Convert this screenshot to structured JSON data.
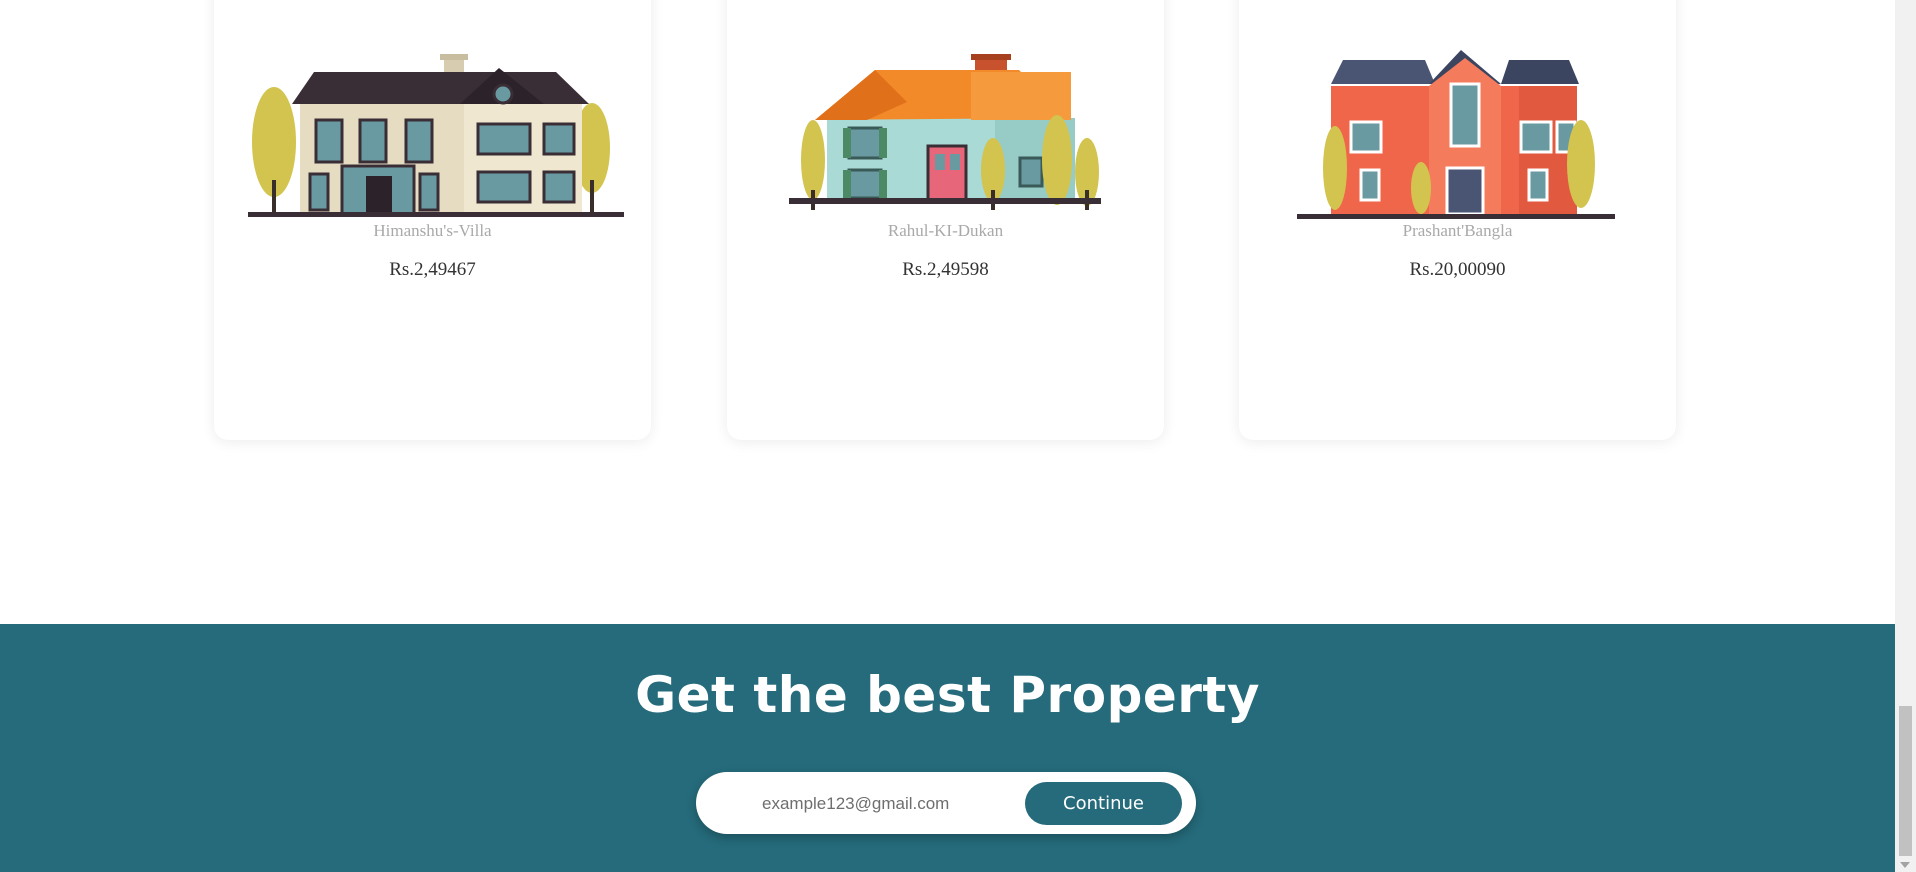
{
  "properties": [
    {
      "name": "Himanshu's-Villa",
      "price": "Rs.2,49467",
      "icon": "villa-house-icon"
    },
    {
      "name": "Rahul-KI-Dukan",
      "price": "Rs.2,49598",
      "icon": "cottage-house-icon"
    },
    {
      "name": "Prashant'Bangla",
      "price": "Rs.20,00090",
      "icon": "brick-bungalow-icon"
    }
  ],
  "cta": {
    "title": "Get the best Property",
    "email_placeholder": "example123@gmail.com",
    "continue_label": "Continue"
  },
  "colors": {
    "cta_background": "#256b7b",
    "button": "#256b7b",
    "name_text": "#a9a9a9",
    "price_text": "#333333"
  }
}
